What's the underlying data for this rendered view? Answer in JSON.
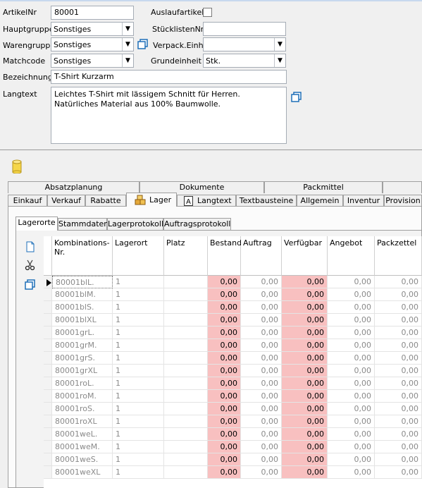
{
  "form": {
    "artikelnr_label": "ArtikelNr",
    "artikelnr_value": "80001",
    "auslaufartikel_label": "Auslaufartikel",
    "hauptgruppe_label": "Hauptgruppe",
    "hauptgruppe_value": "Sonstiges",
    "stuecklistennr_label": "StücklistenNr",
    "stuecklistennr_value": "",
    "warengruppe_label": "Warengruppe",
    "warengruppe_value": "Sonstiges",
    "verpack_label": "Verpack.Einh.",
    "verpack_value": "",
    "matchcode_label": "Matchcode",
    "matchcode_value": "Sonstiges",
    "grundeinheit_label": "Grundeinheit",
    "grundeinheit_value": "Stk.",
    "bezeichnung_label": "Bezeichnung",
    "bezeichnung_value": "T-Shirt Kurzarm",
    "langtext_label": "Langtext",
    "langtext_line1": "Leichtes T-Shirt mit lässigem Schnitt für Herren.",
    "langtext_line2": "Natürliches Material aus 100% Baumwolle."
  },
  "tabs_row1": [
    "Absatzplanung",
    "Dokumente",
    "Packmittel"
  ],
  "tabs_row2": [
    "Einkauf",
    "Verkauf",
    "Rabatte",
    "Lager",
    "Langtext",
    "Textbausteine",
    "Allgemein",
    "Inventur",
    "Provision"
  ],
  "subtabs": [
    "Lagerorte",
    "Stammdaten",
    "Lagerprotokoll",
    "Auftragsprotokoll"
  ],
  "grid": {
    "headers": [
      "Kombinations-\nNr.",
      "Lagerort",
      "Platz",
      "Bestand",
      "Auftrag",
      "Verfügbar",
      "Angebot",
      "Packzettel"
    ],
    "rows": [
      [
        "80001blL.",
        "1",
        "",
        "0,00",
        "0,00",
        "0,00",
        "0,00",
        "0,00"
      ],
      [
        "80001blM.",
        "1",
        "",
        "0,00",
        "0,00",
        "0,00",
        "0,00",
        "0,00"
      ],
      [
        "80001blS.",
        "1",
        "",
        "0,00",
        "0,00",
        "0,00",
        "0,00",
        "0,00"
      ],
      [
        "80001blXL",
        "1",
        "",
        "0,00",
        "0,00",
        "0,00",
        "0,00",
        "0,00"
      ],
      [
        "80001grL.",
        "1",
        "",
        "0,00",
        "0,00",
        "0,00",
        "0,00",
        "0,00"
      ],
      [
        "80001grM.",
        "1",
        "",
        "0,00",
        "0,00",
        "0,00",
        "0,00",
        "0,00"
      ],
      [
        "80001grS.",
        "1",
        "",
        "0,00",
        "0,00",
        "0,00",
        "0,00",
        "0,00"
      ],
      [
        "80001grXL",
        "1",
        "",
        "0,00",
        "0,00",
        "0,00",
        "0,00",
        "0,00"
      ],
      [
        "80001roL.",
        "1",
        "",
        "0,00",
        "0,00",
        "0,00",
        "0,00",
        "0,00"
      ],
      [
        "80001roM.",
        "1",
        "",
        "0,00",
        "0,00",
        "0,00",
        "0,00",
        "0,00"
      ],
      [
        "80001roS.",
        "1",
        "",
        "0,00",
        "0,00",
        "0,00",
        "0,00",
        "0,00"
      ],
      [
        "80001roXL",
        "1",
        "",
        "0,00",
        "0,00",
        "0,00",
        "0,00",
        "0,00"
      ],
      [
        "80001weL.",
        "1",
        "",
        "0,00",
        "0,00",
        "0,00",
        "0,00",
        "0,00"
      ],
      [
        "80001weM.",
        "1",
        "",
        "0,00",
        "0,00",
        "0,00",
        "0,00",
        "0,00"
      ],
      [
        "80001weS.",
        "1",
        "",
        "0,00",
        "0,00",
        "0,00",
        "0,00",
        "0,00"
      ],
      [
        "80001weXL",
        "1",
        "",
        "0,00",
        "0,00",
        "0,00",
        "0,00",
        "0,00"
      ]
    ]
  },
  "icons": {
    "database": "database-icon",
    "copy": "copy-icon",
    "new": "new-document-icon",
    "cut": "scissors-icon",
    "row_indicator": "row-pointer-icon"
  },
  "colors": {
    "highlight_cells": "#f8c0c0",
    "background": "#f0f0f0",
    "accent_blue": "#1e6fb8"
  }
}
